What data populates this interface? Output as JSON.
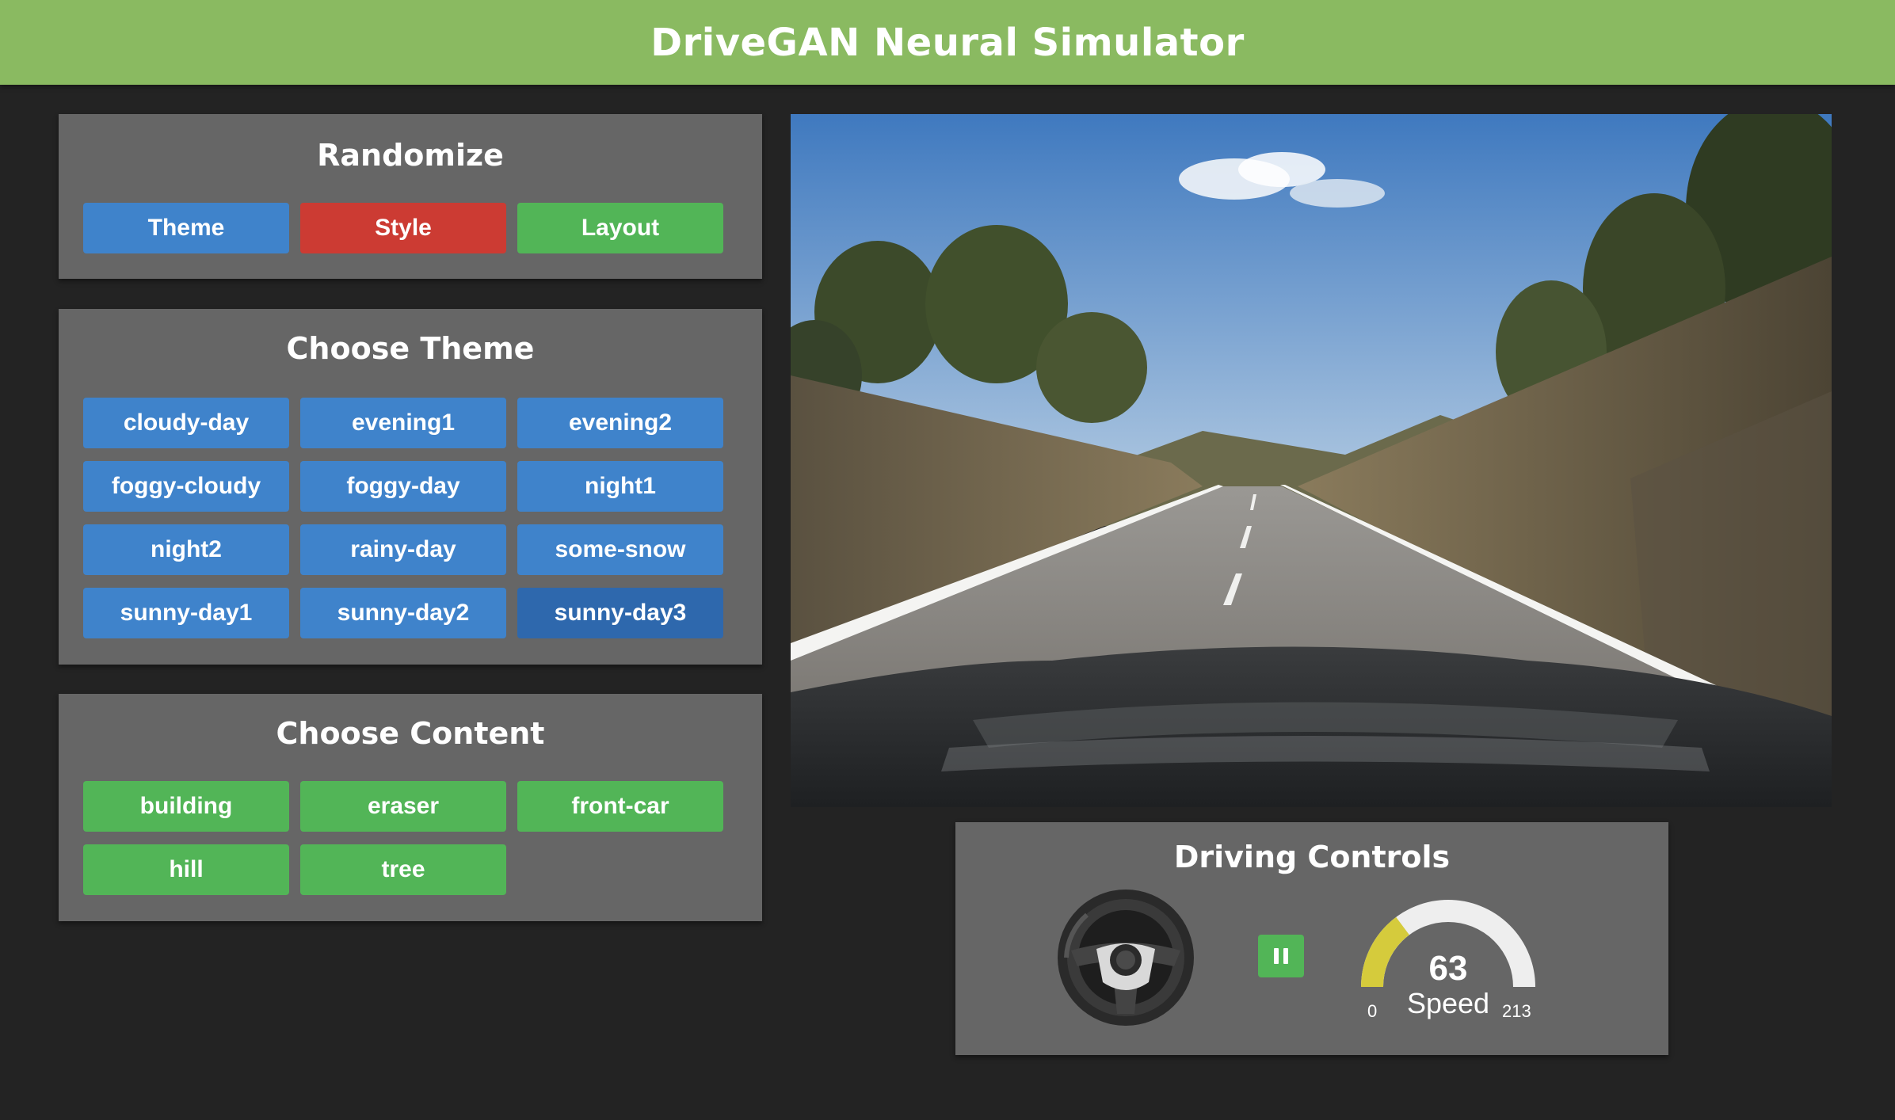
{
  "header": {
    "title": "DriveGAN Neural Simulator"
  },
  "randomize": {
    "title": "Randomize",
    "buttons": [
      "Theme",
      "Style",
      "Layout"
    ]
  },
  "theme": {
    "title": "Choose Theme",
    "items": [
      "cloudy-day",
      "evening1",
      "evening2",
      "foggy-cloudy",
      "foggy-day",
      "night1",
      "night2",
      "rainy-day",
      "some-snow",
      "sunny-day1",
      "sunny-day2",
      "sunny-day3"
    ],
    "selected": "sunny-day3"
  },
  "content": {
    "title": "Choose Content",
    "items": [
      "building",
      "eraser",
      "front-car",
      "hill",
      "tree"
    ]
  },
  "controls": {
    "title": "Driving Controls",
    "steering_icon": "steering-wheel-icon",
    "pause_icon": "pause-icon",
    "speed": {
      "value": "63",
      "label": "Speed",
      "min": "0",
      "max": "213"
    }
  },
  "colors": {
    "header_bg": "#8aba61",
    "page_bg": "#232323",
    "panel_bg": "#666666",
    "blue": "#3f83cb",
    "blue_active": "#2e68ad",
    "red": "#cc3b33",
    "green": "#52b557",
    "gauge_fill": "#d5cb3c",
    "gauge_track": "#eeeeee"
  }
}
